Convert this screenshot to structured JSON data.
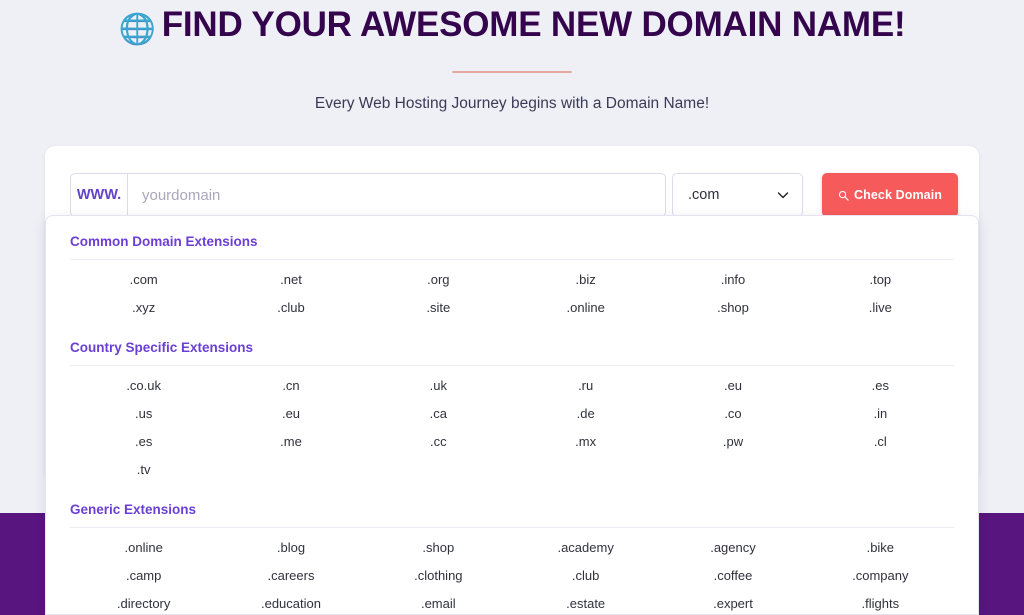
{
  "hero": {
    "icon": "globe-icon",
    "title": "FIND YOUR AWESOME NEW DOMAIN NAME!",
    "subtitle": "Every Web Hosting Journey begins with a Domain Name!",
    "title_color": "#34054d",
    "divider_color": "#e8a79e"
  },
  "search": {
    "www_prefix": "WWW.",
    "input_value": "",
    "input_placeholder": "yourdomain",
    "tld_selected": ".com",
    "dropdown_icon": "chevron-down-icon",
    "button_label": "Check Domain",
    "button_icon": "search-icon",
    "button_color": "#f75a5a"
  },
  "extension_panel": {
    "heading_color": "#6b3fd4",
    "sections": [
      {
        "title": "Common Domain Extensions",
        "items": [
          ".com",
          ".net",
          ".org",
          ".biz",
          ".info",
          ".top",
          ".xyz",
          ".club",
          ".site",
          ".online",
          ".shop",
          ".live"
        ]
      },
      {
        "title": "Country Specific Extensions",
        "items": [
          ".co.uk",
          ".cn",
          ".uk",
          ".ru",
          ".eu",
          ".es",
          ".us",
          ".eu",
          ".ca",
          ".de",
          ".co",
          ".in",
          ".es",
          ".me",
          ".cc",
          ".mx",
          ".pw",
          ".cl",
          ".tv"
        ]
      },
      {
        "title": "Generic Extensions",
        "items": [
          ".online",
          ".blog",
          ".shop",
          ".academy",
          ".agency",
          ".bike",
          ".camp",
          ".careers",
          ".clothing",
          ".club",
          ".coffee",
          ".company",
          ".directory",
          ".education",
          ".email",
          ".estate",
          ".expert",
          ".flights"
        ]
      }
    ]
  },
  "page": {
    "background_color": "#eef0f6",
    "band_color": "#59157f"
  }
}
